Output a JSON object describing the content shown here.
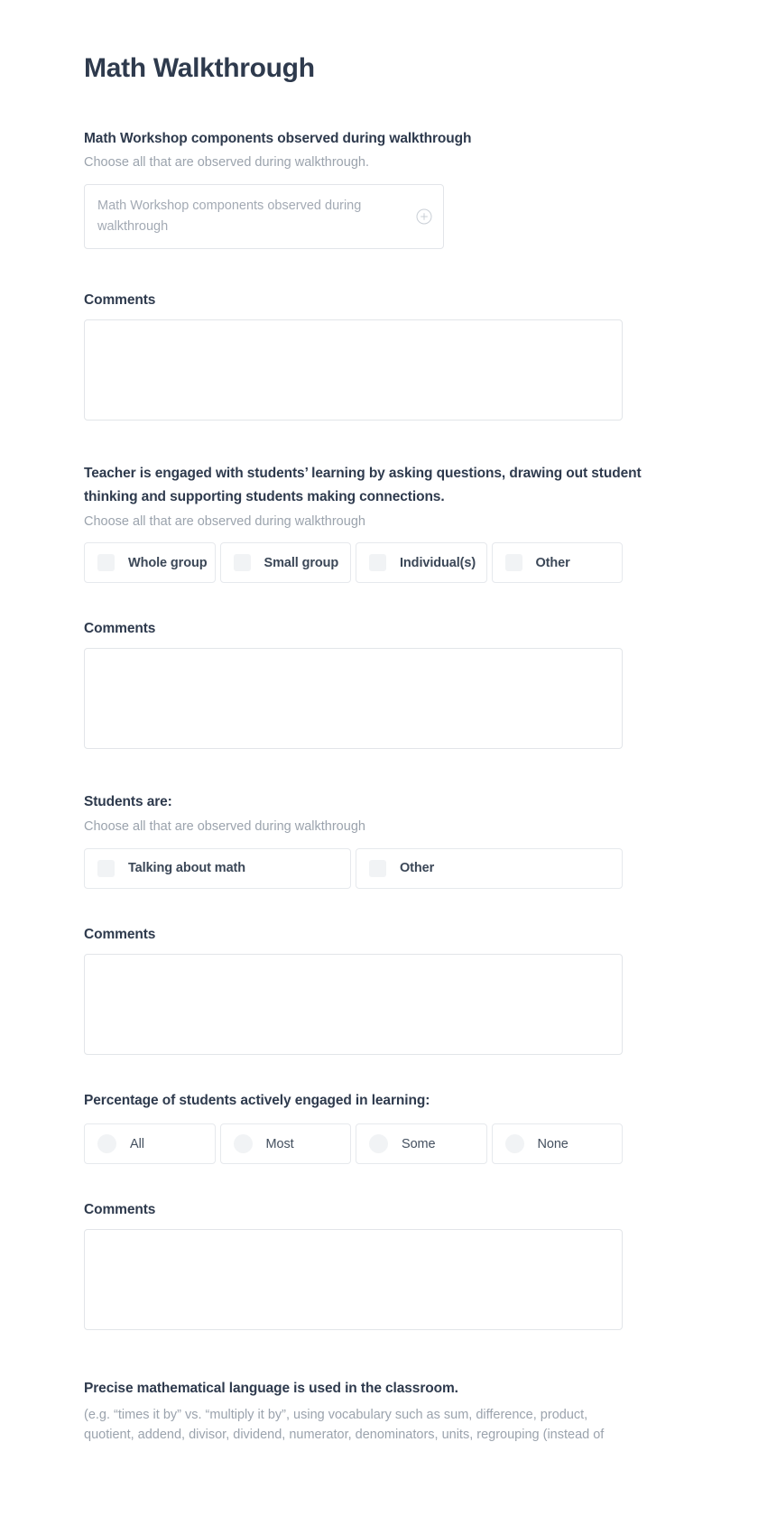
{
  "page": {
    "title": "Math Walkthrough"
  },
  "icons": {
    "plus": "plus-circle-icon"
  },
  "sections": [
    {
      "id": "math-workshop-components",
      "title": "Math Workshop components observed during walkthrough",
      "subtitle": "Choose all that are observed during walkthrough.",
      "control": "multiselect",
      "placeholder": "Math Workshop components observed during walkthrough",
      "value": ""
    },
    {
      "id": "teacher-engagement",
      "title": "Teacher is engaged with students’ learning by asking questions, drawing out student thinking and supporting students making connections.",
      "subtitle": "Choose all that are observed during walkthrough",
      "control": "checkbox",
      "options": [
        {
          "label": "Whole group",
          "checked": false
        },
        {
          "label": "Small group",
          "checked": false
        },
        {
          "label": "Individual(s)",
          "checked": false
        },
        {
          "label": "Other",
          "checked": false
        }
      ]
    },
    {
      "id": "students-are",
      "title": "Students are:",
      "subtitle": "Choose all that are observed during walkthrough",
      "control": "checkbox",
      "options": [
        {
          "label": "Talking about math",
          "checked": false
        },
        {
          "label": "Other",
          "checked": false
        }
      ]
    },
    {
      "id": "percentage-engaged",
      "title": "Percentage of students actively engaged in learning:",
      "subtitle": "",
      "control": "radio",
      "options": [
        {
          "label": "All",
          "selected": false
        },
        {
          "label": "Most",
          "selected": false
        },
        {
          "label": "Some",
          "selected": false
        },
        {
          "label": "None",
          "selected": false
        }
      ]
    },
    {
      "id": "precise-language",
      "title": "Precise mathematical language is used in the classroom.",
      "subtitle": "(e.g. “times it by” vs. “multiply it by”, using vocabulary such as sum, difference, product, quotient, addend, divisor, dividend, numerator, denominators, units, regrouping (instead of"
    }
  ],
  "comments": {
    "label": "Comments",
    "value": ""
  }
}
